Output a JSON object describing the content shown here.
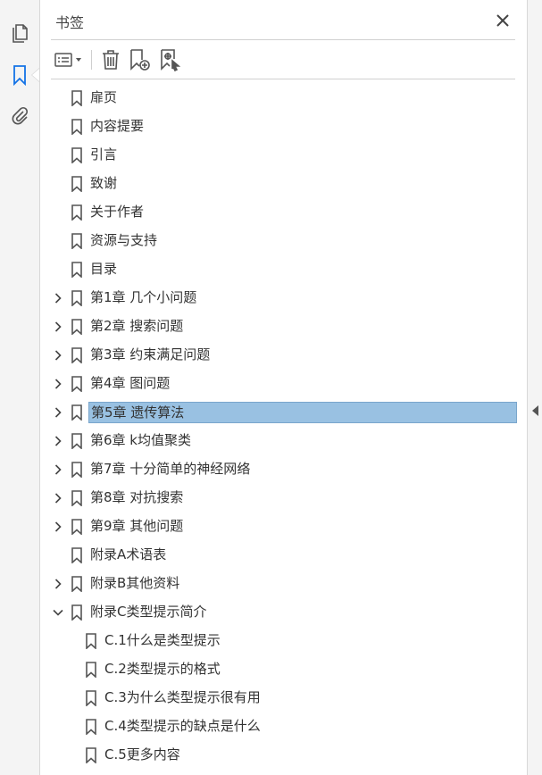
{
  "panel": {
    "title": "书签"
  },
  "leftbar": {
    "icons": [
      "pages-icon",
      "bookmarks-icon",
      "attachments-icon"
    ]
  },
  "toolbar": {
    "buttons": [
      "options-menu-icon",
      "delete-bookmark-icon",
      "new-bookmark-icon",
      "new-bookmark-from-structure-icon"
    ]
  },
  "bookmarks": [
    {
      "label": "扉页",
      "expandable": false,
      "level": 0
    },
    {
      "label": "内容提要",
      "expandable": false,
      "level": 0
    },
    {
      "label": "引言",
      "expandable": false,
      "level": 0
    },
    {
      "label": "致谢",
      "expandable": false,
      "level": 0
    },
    {
      "label": "关于作者",
      "expandable": false,
      "level": 0
    },
    {
      "label": "资源与支持",
      "expandable": false,
      "level": 0
    },
    {
      "label": "目录",
      "expandable": false,
      "level": 0
    },
    {
      "label": "第1章 几个小问题",
      "expandable": true,
      "level": 0
    },
    {
      "label": "第2章 搜索问题",
      "expandable": true,
      "level": 0
    },
    {
      "label": "第3章 约束满足问题",
      "expandable": true,
      "level": 0
    },
    {
      "label": "第4章 图问题",
      "expandable": true,
      "level": 0
    },
    {
      "label": "第5章 遗传算法",
      "expandable": true,
      "level": 0,
      "selected": true
    },
    {
      "label": "第6章 k均值聚类",
      "expandable": true,
      "level": 0
    },
    {
      "label": "第7章 十分简单的神经网络",
      "expandable": true,
      "level": 0
    },
    {
      "label": "第8章 对抗搜索",
      "expandable": true,
      "level": 0
    },
    {
      "label": "第9章 其他问题",
      "expandable": true,
      "level": 0
    },
    {
      "label": "附录A术语表",
      "expandable": false,
      "level": 0
    },
    {
      "label": "附录B其他资料",
      "expandable": true,
      "level": 0
    },
    {
      "label": "附录C类型提示简介",
      "expandable": true,
      "expanded": true,
      "level": 0
    },
    {
      "label": "C.1什么是类型提示",
      "expandable": false,
      "level": 1
    },
    {
      "label": "C.2类型提示的格式",
      "expandable": false,
      "level": 1
    },
    {
      "label": "C.3为什么类型提示很有用",
      "expandable": false,
      "level": 1
    },
    {
      "label": "C.4类型提示的缺点是什么",
      "expandable": false,
      "level": 1
    },
    {
      "label": "C.5更多内容",
      "expandable": false,
      "level": 1
    }
  ],
  "colors": {
    "accent": "#1473e6",
    "selection": "#99c1e2",
    "icon": "#555555"
  }
}
